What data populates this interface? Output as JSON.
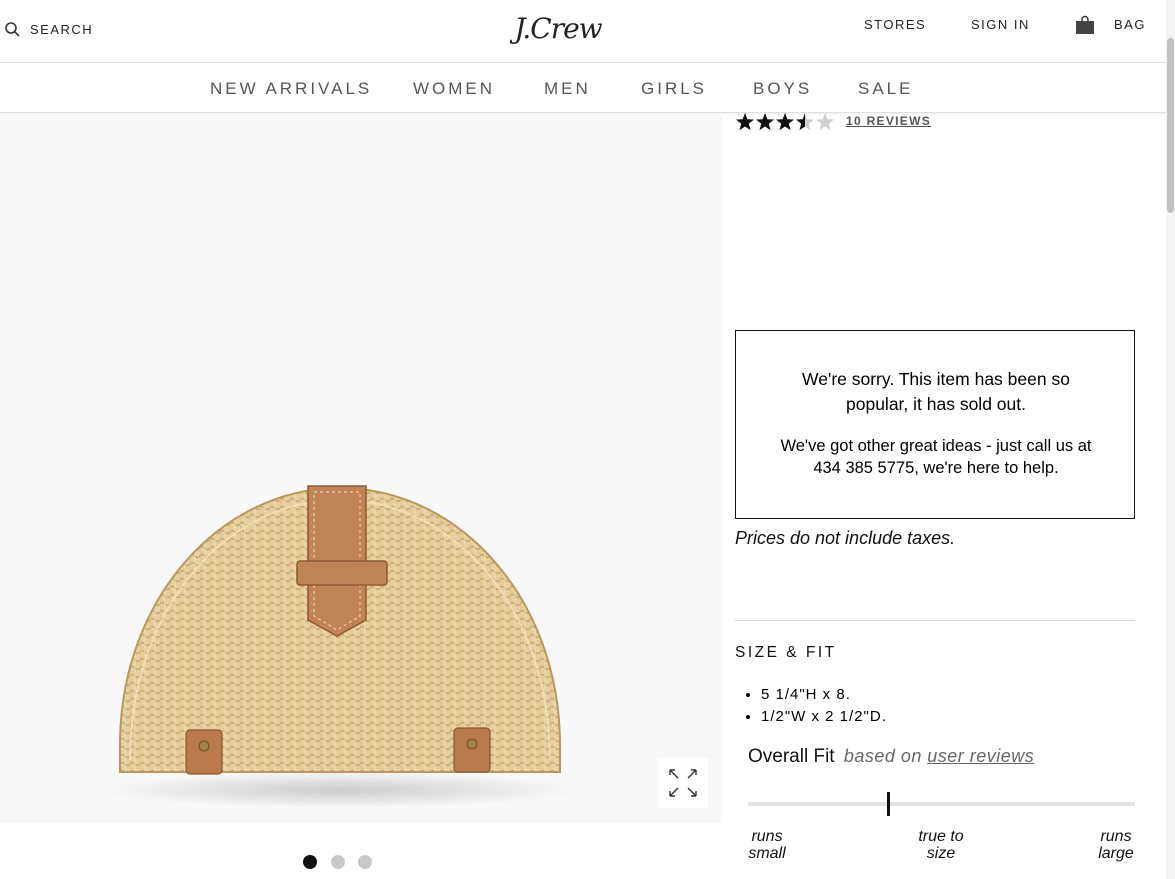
{
  "header": {
    "search_label": "SEARCH",
    "logo": "J.Crew",
    "stores": "STORES",
    "sign_in": "SIGN IN",
    "bag": "BAG"
  },
  "nav": {
    "items": [
      "NEW ARRIVALS",
      "WOMEN",
      "MEN",
      "GIRLS",
      "BOYS",
      "SALE"
    ]
  },
  "product": {
    "rating": 3.5,
    "rating_max": 5,
    "reviews_link": "10 REVIEWS",
    "image_slide_count": 3,
    "active_slide": 1
  },
  "soldout": {
    "title": "We're sorry. This item has been so popular, it has sold out.",
    "message": "We've got other great ideas - just call us at 434 385 5775, we're here to help."
  },
  "taxes_note": "Prices do not include taxes.",
  "size_fit": {
    "title": "SIZE & FIT",
    "bullets": [
      "5 1/4\"H x 8.",
      "1/2\"W x 2 1/2\"D."
    ],
    "overall_fit_label": "Overall Fit",
    "based_on": "based on",
    "user_reviews_link": "user reviews",
    "fit_position": 0.36,
    "scale_labels": {
      "left_line1": "runs",
      "left_line2": "small",
      "mid_line1": "true to",
      "mid_line2": "size",
      "right_line1": "runs",
      "right_line2": "large"
    }
  },
  "colors": {
    "nav_text": "#555555",
    "strap": "#b57a4f",
    "wicker": "#e3cd9d"
  }
}
